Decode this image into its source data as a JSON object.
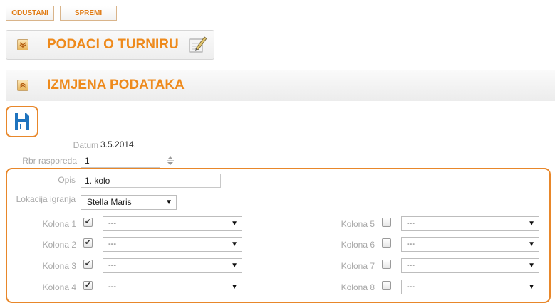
{
  "toolbar": {
    "cancel_label": "ODUSTANI",
    "save_label": "SPREMI"
  },
  "sections": {
    "tournament_title": "PODACI O TURNIRU",
    "edit_title": "IZMJENA PODATAKA"
  },
  "form": {
    "datum_label": "Datum",
    "datum_value": "3.5.2014.",
    "rbr_label": "Rbr rasporeda",
    "rbr_value": "1",
    "opis_label": "Opis",
    "opis_value": "1. kolo",
    "lokacija_label": "Lokacija igranja",
    "lokacija_value": "Stella Maris"
  },
  "columns": [
    {
      "label": "Kolona 1",
      "checked": true,
      "value": "---"
    },
    {
      "label": "Kolona 2",
      "checked": true,
      "value": "---"
    },
    {
      "label": "Kolona 3",
      "checked": true,
      "value": "---"
    },
    {
      "label": "Kolona 4",
      "checked": true,
      "value": "---"
    },
    {
      "label": "Kolona 5",
      "checked": false,
      "value": "---"
    },
    {
      "label": "Kolona 6",
      "checked": false,
      "value": "---"
    },
    {
      "label": "Kolona 7",
      "checked": false,
      "value": "---"
    },
    {
      "label": "Kolona 8",
      "checked": false,
      "value": "---"
    }
  ],
  "colors": {
    "accent": "#ee8a1c",
    "save_icon": "#1e73be",
    "label": "#a8a8a8"
  },
  "icons": {
    "collapse": "chevron-down-icon",
    "expand": "chevron-up-icon",
    "edit": "edit-icon",
    "save": "floppy-disk-icon",
    "spinner": "spinner-arrows-icon"
  }
}
